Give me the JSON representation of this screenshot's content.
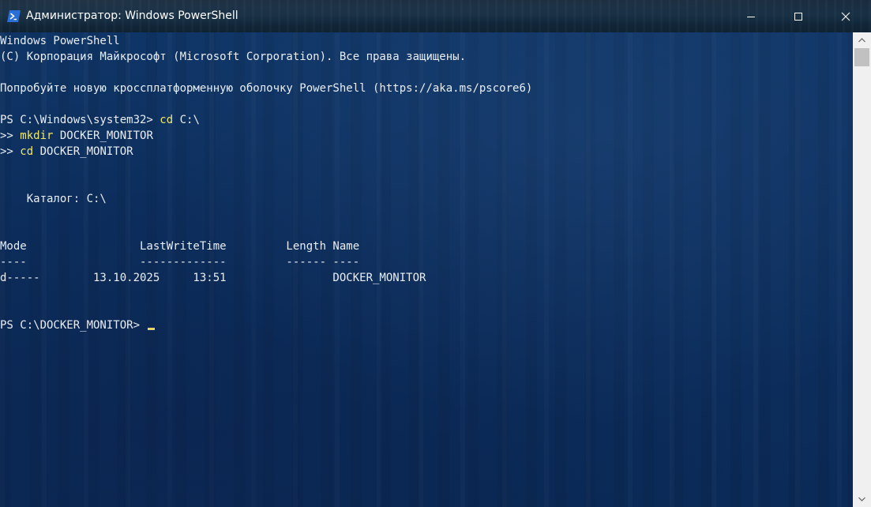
{
  "window": {
    "title": "Администратор: Windows PowerShell",
    "icon": "powershell-icon",
    "buttons": {
      "minimize": "minimize-icon",
      "maximize": "maximize-icon",
      "close": "close-icon"
    }
  },
  "console": {
    "header1": "Windows PowerShell",
    "header2": "(C) Корпорация Майкрософт (Microsoft Corporation). Все права защищены.",
    "header3": "Попробуйте новую кроссплатформенную оболочку PowerShell (https://aka.ms/pscore6)",
    "cmd1_prompt": "PS C:\\Windows\\system32> ",
    "cmd1_keyword": "cd",
    "cmd1_arg": " C:\\",
    "cont_prompt": ">> ",
    "cmd2_keyword": "mkdir",
    "cmd2_arg": " DOCKER_MONITOR",
    "cmd3_keyword": "cd",
    "cmd3_arg": " DOCKER_MONITOR",
    "directory_line": "    Каталог: C:\\",
    "table": {
      "header": "Mode                 LastWriteTime         Length Name",
      "underline": "----                 -------------         ------ ----",
      "rows": [
        "d-----        13.10.2025     13:51                DOCKER_MONITOR"
      ]
    },
    "final_prompt": "PS C:\\DOCKER_MONITOR>",
    "colors": {
      "text": "#eaeef3",
      "keyword": "#f1e76a",
      "cursor": "#e8d26a"
    }
  }
}
